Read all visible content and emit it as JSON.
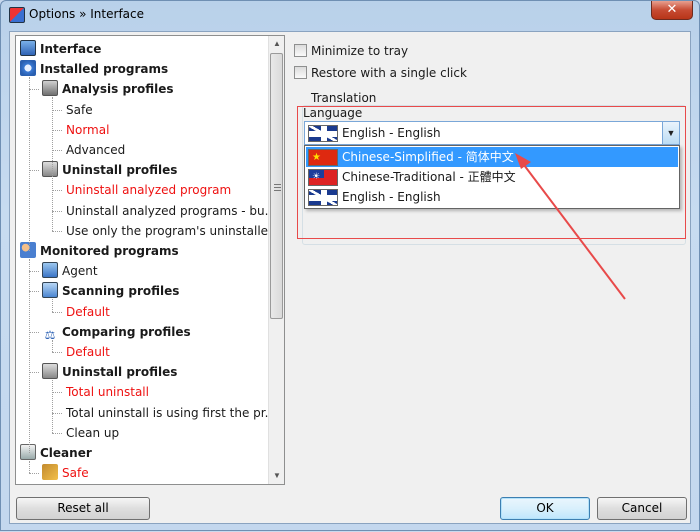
{
  "window": {
    "title": "Options » Interface",
    "close_label": "✕"
  },
  "tree": {
    "items": [
      {
        "label": "Interface",
        "level": 0,
        "bold": true,
        "red": false,
        "icon": "monitor-icon"
      },
      {
        "label": "Installed programs",
        "level": 0,
        "bold": true,
        "red": false,
        "icon": "disk-icon"
      },
      {
        "label": "Analysis profiles",
        "level": 1,
        "bold": true,
        "red": false,
        "icon": "analysis-icon"
      },
      {
        "label": "Safe",
        "level": 2,
        "bold": false,
        "red": false,
        "icon": ""
      },
      {
        "label": "Normal",
        "level": 2,
        "bold": false,
        "red": true,
        "icon": ""
      },
      {
        "label": "Advanced",
        "level": 2,
        "bold": false,
        "red": false,
        "icon": ""
      },
      {
        "label": "Uninstall profiles",
        "level": 1,
        "bold": true,
        "red": false,
        "icon": "trash-icon"
      },
      {
        "label": "Uninstall analyzed program",
        "level": 2,
        "bold": false,
        "red": true,
        "icon": ""
      },
      {
        "label": "Uninstall analyzed programs - bu...",
        "level": 2,
        "bold": false,
        "red": false,
        "icon": ""
      },
      {
        "label": "Use only the program's uninstaller",
        "level": 2,
        "bold": false,
        "red": false,
        "icon": ""
      },
      {
        "label": "Monitored programs",
        "level": 0,
        "bold": true,
        "red": false,
        "icon": "people-icon"
      },
      {
        "label": "Agent",
        "level": 1,
        "bold": false,
        "red": false,
        "icon": "agent-icon"
      },
      {
        "label": "Scanning profiles",
        "level": 1,
        "bold": true,
        "red": false,
        "icon": "scan-icon"
      },
      {
        "label": "Default",
        "level": 2,
        "bold": false,
        "red": true,
        "icon": ""
      },
      {
        "label": "Comparing profiles",
        "level": 1,
        "bold": true,
        "red": false,
        "icon": "scale-icon"
      },
      {
        "label": "Default",
        "level": 2,
        "bold": false,
        "red": true,
        "icon": ""
      },
      {
        "label": "Uninstall profiles",
        "level": 1,
        "bold": true,
        "red": false,
        "icon": "trash-icon"
      },
      {
        "label": "Total uninstall",
        "level": 2,
        "bold": false,
        "red": true,
        "icon": ""
      },
      {
        "label": "Total uninstall is using first the pr...",
        "level": 2,
        "bold": false,
        "red": false,
        "icon": ""
      },
      {
        "label": "Clean up",
        "level": 2,
        "bold": false,
        "red": false,
        "icon": ""
      },
      {
        "label": "Cleaner",
        "level": 0,
        "bold": true,
        "red": false,
        "icon": "cleaner-icon"
      },
      {
        "label": "Safe",
        "level": 1,
        "bold": false,
        "red": true,
        "icon": "broom-icon"
      }
    ]
  },
  "options": {
    "minimize_to_tray": {
      "label": "Minimize to tray",
      "checked": false
    },
    "restore_single_click": {
      "label": "Restore with a single click",
      "checked": false
    }
  },
  "translation": {
    "group_label": "Translation",
    "language_label": "Language",
    "selected_value": "English - English",
    "selected_flag": "uk-flag-icon",
    "options": [
      {
        "label": "Chinese-Simplified - 简体中文",
        "flag": "china-flag-icon",
        "highlighted": true
      },
      {
        "label": "Chinese-Traditional - 正體中文",
        "flag": "taiwan-flag-icon",
        "highlighted": false
      },
      {
        "label": "English - English",
        "flag": "uk-flag-icon",
        "highlighted": false
      }
    ]
  },
  "buttons": {
    "reset_all": "Reset all",
    "ok": "OK",
    "cancel": "Cancel"
  },
  "colors": {
    "highlight": "#3399ff",
    "annotation_red": "#e84a4a",
    "tree_red_text": "#e11111"
  }
}
